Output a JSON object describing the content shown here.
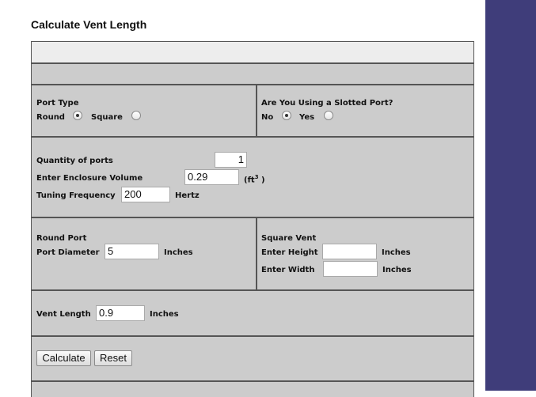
{
  "page": {
    "title": "Calculate Vent Length"
  },
  "port_type": {
    "label": "Port Type",
    "options": [
      {
        "label": "Round",
        "selected": true
      },
      {
        "label": "Square",
        "selected": false
      }
    ]
  },
  "slotted": {
    "label": "Are You Using a Slotted Port?",
    "options": [
      {
        "label": "No",
        "selected": true
      },
      {
        "label": "Yes",
        "selected": false
      }
    ]
  },
  "quantity": {
    "label": "Quantity of ports",
    "value": "1"
  },
  "volume": {
    "label": "Enter Enclosure Volume",
    "value": "0.29",
    "unit_prefix": "(ft",
    "unit_exp": "3",
    "unit_suffix": " )"
  },
  "tuning": {
    "label": "Tuning Frequency",
    "value": "200",
    "unit": "Hertz"
  },
  "round_port": {
    "heading": "Round Port",
    "diameter_label": "Port Diameter",
    "diameter_value": "5",
    "unit": "Inches"
  },
  "square_vent": {
    "heading": "Square Vent",
    "height_label": "Enter Height",
    "height_value": "",
    "height_unit": "Inches",
    "width_label": "Enter Width",
    "width_value": "",
    "width_unit": "Inches"
  },
  "vent_length": {
    "label": "Vent Length",
    "value": "0.9",
    "unit": "Inches"
  },
  "actions": {
    "calculate": "Calculate",
    "reset": "Reset"
  },
  "colors": {
    "sidebar": "#3f3d7a",
    "panel": "#cccccc",
    "border": "#555555"
  }
}
